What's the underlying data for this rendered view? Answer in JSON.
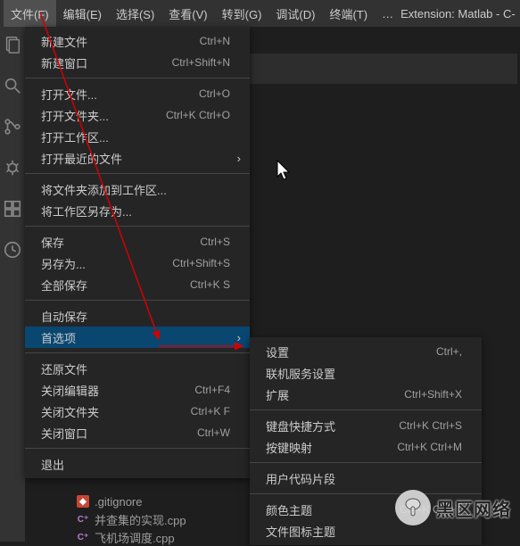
{
  "menubar": {
    "items": [
      {
        "label": "文件(F)"
      },
      {
        "label": "编辑(E)"
      },
      {
        "label": "选择(S)"
      },
      {
        "label": "查看(V)"
      },
      {
        "label": "转到(G)"
      },
      {
        "label": "调试(D)"
      },
      {
        "label": "终端(T)"
      }
    ],
    "ellipsis": "…",
    "title_right": "Extension: Matlab - C-"
  },
  "file_menu": {
    "groups": [
      [
        {
          "label": "新建文件",
          "keys": "Ctrl+N"
        },
        {
          "label": "新建窗口",
          "keys": "Ctrl+Shift+N"
        }
      ],
      [
        {
          "label": "打开文件...",
          "keys": "Ctrl+O"
        },
        {
          "label": "打开文件夹...",
          "keys": "Ctrl+K Ctrl+O"
        },
        {
          "label": "打开工作区..."
        },
        {
          "label": "打开最近的文件",
          "submenu": true
        }
      ],
      [
        {
          "label": "将文件夹添加到工作区..."
        },
        {
          "label": "将工作区另存为..."
        }
      ],
      [
        {
          "label": "保存",
          "keys": "Ctrl+S"
        },
        {
          "label": "另存为...",
          "keys": "Ctrl+Shift+S"
        },
        {
          "label": "全部保存",
          "keys": "Ctrl+K S"
        }
      ],
      [
        {
          "label": "自动保存"
        },
        {
          "label": "首选项",
          "submenu": true,
          "hover": true
        }
      ],
      [
        {
          "label": "还原文件"
        },
        {
          "label": "关闭编辑器",
          "keys": "Ctrl+F4"
        },
        {
          "label": "关闭文件夹",
          "keys": "Ctrl+K F"
        },
        {
          "label": "关闭窗口",
          "keys": "Ctrl+W"
        }
      ],
      [
        {
          "label": "退出"
        }
      ]
    ]
  },
  "prefs_submenu": {
    "groups": [
      [
        {
          "label": "设置",
          "keys": "Ctrl+,"
        },
        {
          "label": "联机服务设置"
        },
        {
          "label": "扩展",
          "keys": "Ctrl+Shift+X"
        }
      ],
      [
        {
          "label": "键盘快捷方式",
          "keys": "Ctrl+K Ctrl+S"
        },
        {
          "label": "按键映射",
          "keys": "Ctrl+K Ctrl+M"
        }
      ],
      [
        {
          "label": "用户代码片段"
        }
      ],
      [
        {
          "label": "颜色主题",
          "keys": "Ctrl+K Ctrl+T"
        },
        {
          "label": "文件图标主题"
        }
      ]
    ]
  },
  "explorer_files": [
    {
      "icon": "git",
      "name": ".gitignore"
    },
    {
      "icon": "cpp",
      "name": "并查集的实现.cpp"
    },
    {
      "icon": "cpp",
      "name": "飞机场调度.cpp"
    }
  ],
  "watermark": {
    "text": "黑区网络"
  }
}
